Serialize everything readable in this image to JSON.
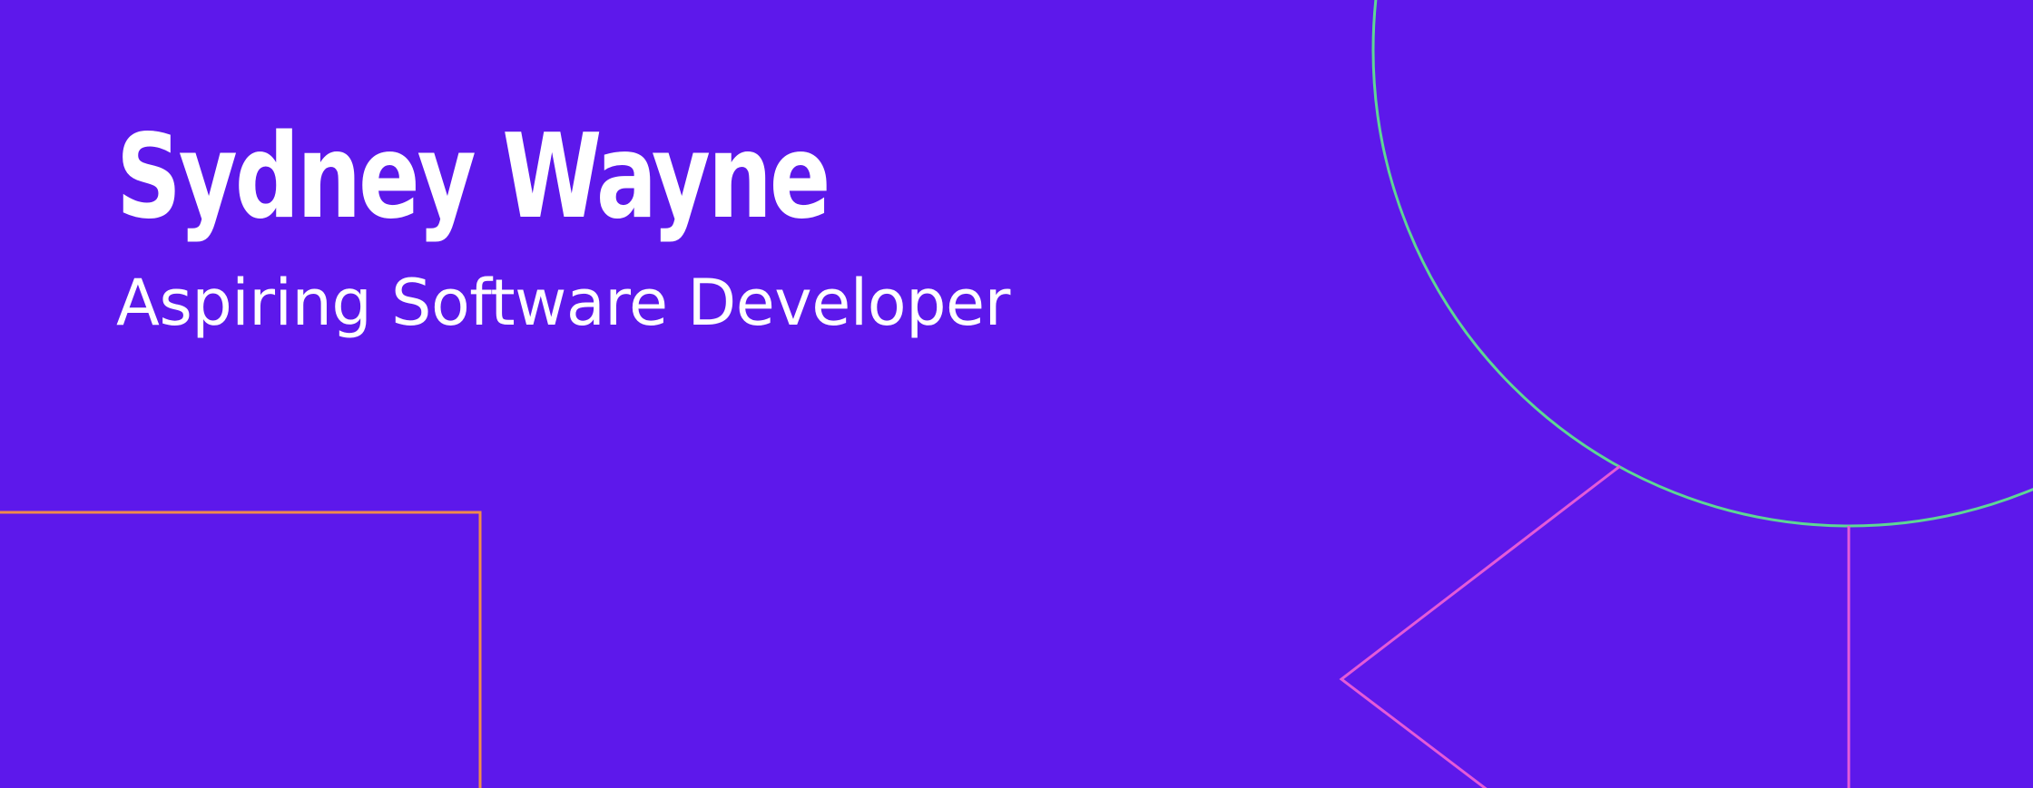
{
  "profile": {
    "name": "Sydney Wayne",
    "tagline": "Aspiring Software Developer"
  },
  "theme": {
    "background": "#5d18eb",
    "text": "#ffffff",
    "circle_outline": "#5ed694",
    "rectangle_outline": "#f08a4b",
    "pink_outline": "#e45ad8"
  }
}
